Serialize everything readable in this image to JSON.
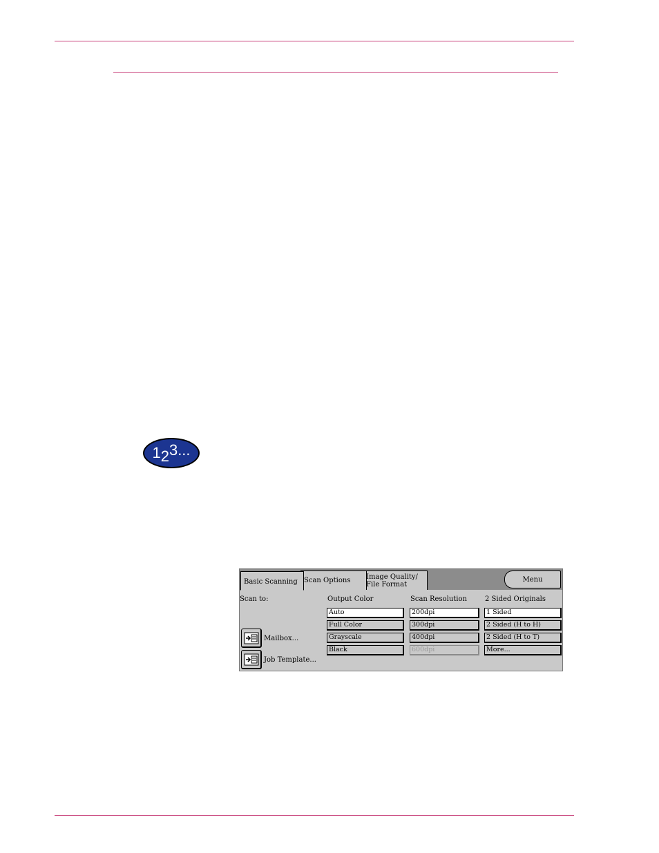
{
  "step_badge": {
    "text": "1",
    "sub": "2",
    "rest": "3..."
  },
  "panel": {
    "tabs": {
      "basic": "Basic Scanning",
      "scan_options": "Scan Options",
      "image_quality": "Image Quality/\nFile Format"
    },
    "menu_label": "Menu",
    "scan_to": {
      "heading": "Scan to:",
      "mailbox": "Mailbox...",
      "job_template": "Job Template..."
    },
    "output_color": {
      "heading": "Output Color",
      "options": [
        "Auto",
        "Full Color",
        "Grayscale",
        "Black"
      ],
      "selected": "Auto"
    },
    "scan_resolution": {
      "heading": "Scan Resolution",
      "options": [
        "200dpi",
        "300dpi",
        "400dpi",
        "600dpi"
      ],
      "selected": "200dpi",
      "disabled": "600dpi"
    },
    "sided_originals": {
      "heading": "2 Sided Originals",
      "options": [
        "1 Sided",
        "2 Sided (H to H)",
        "2 Sided (H to T)",
        "More..."
      ],
      "selected": "1 Sided"
    }
  },
  "colors": {
    "rule": "#c8407a",
    "badge": "#1c3591",
    "panel": "#c9c9c9"
  }
}
